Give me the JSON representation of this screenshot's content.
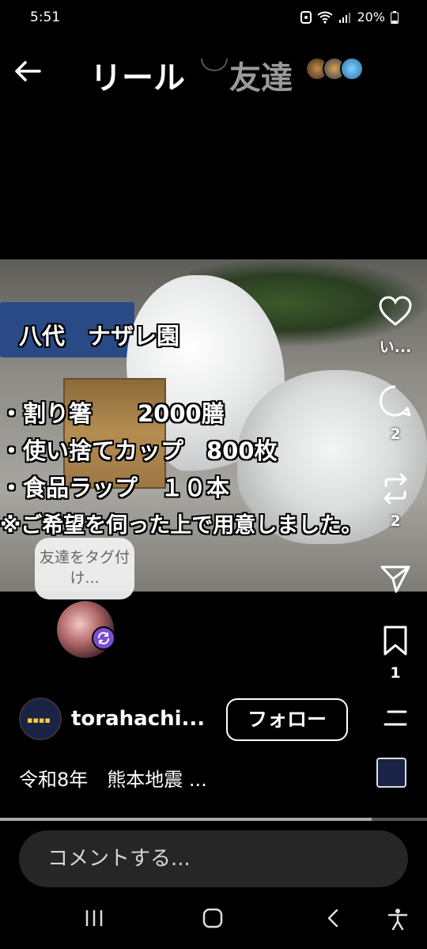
{
  "status_bar": {
    "time": "5:51",
    "battery": "20%"
  },
  "header": {
    "title": "リール",
    "friends_tab": "友達"
  },
  "video_overlay": {
    "lines": [
      "八代　ナザレ園",
      "・割り箸　　2000膳",
      "・使い捨てカップ　800枚",
      "・食品ラップ　１０本",
      "※ご希望を伺った上で用意しました。"
    ]
  },
  "actions": {
    "like_label": "い...",
    "comment_count": "2",
    "repost_count": "2",
    "save_count": "1"
  },
  "tag_bubble": {
    "text": "友達をタグ付け..."
  },
  "author": {
    "username": "torahachi...",
    "follow_label": "フォロー"
  },
  "caption": "令和8年　熊本地震 ...",
  "comment_input": {
    "placeholder": "コメントする..."
  },
  "playback": {
    "progress": 0.87
  },
  "colors": {
    "background": "#000000",
    "accent_badge": "#7a4fd6",
    "inactive_tab": "#9a9a9a"
  }
}
